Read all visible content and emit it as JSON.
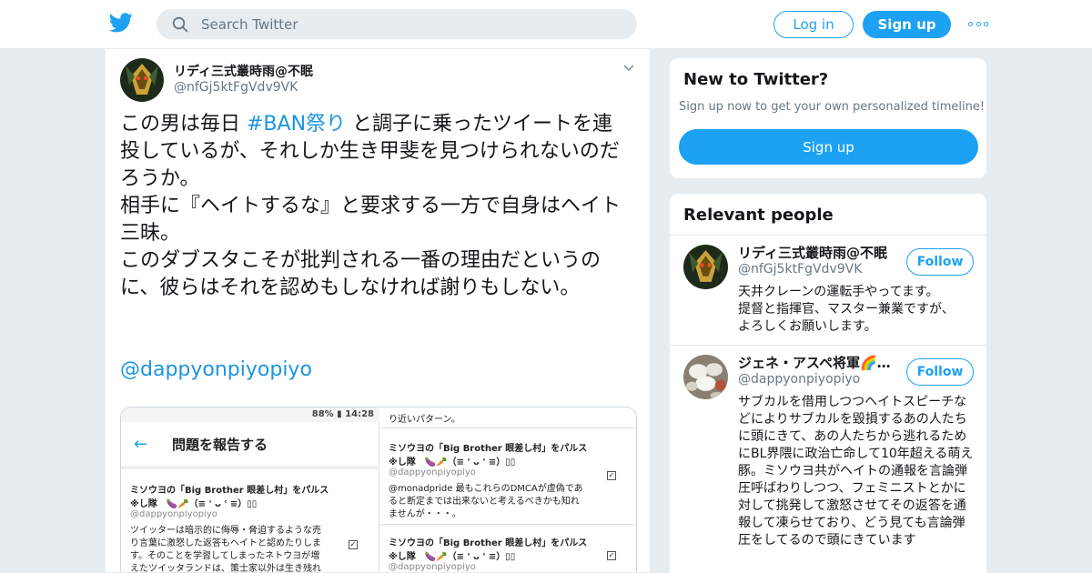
{
  "search": {
    "placeholder": "Search Twitter"
  },
  "header": {
    "login_label": "Log in",
    "signup_label": "Sign up"
  },
  "tweet": {
    "author_name": "リディ三式叢時雨@不眠",
    "author_handle": "@nfGj5ktFgVdv9VK",
    "text_before": "この男は毎日 ",
    "hashtag": "#BAN祭り",
    "text_after": " と調子に乗ったツイートを連投しているが、それしか生き甲斐を見つけられないのだろうか。\n相手に『ヘイトするな』と要求する一方で自身はヘイト三昧。\nこのダブスタこそが批判される一番の理由だというのに、彼らはそれを認めもしなければ謝りもしない。",
    "mention": "@dappyonpiyopiyo"
  },
  "screenshot": {
    "status": "88% ▮ 14:28",
    "app_title": "問題を報告する",
    "left_item": {
      "title": "ミソウヨの「Big Brother 眼差し村」をパルス",
      "title2": "※し隊　🍆🥕（≡ ' ᴗ ' ≡）▯▯",
      "handle": "@dappyonpiyopiyo",
      "line1": "ツイッターは暗示的に侮辱・脅迫するような売",
      "line2": "り言葉に激怒した返答もヘイトと認めたりしま",
      "line3": "す。そのことを学習してしまったネトウヨが増",
      "line4": "えたツイッタランドは、策士家以外は生き残れ"
    },
    "right_top": "り近いパターン。",
    "right_item1": {
      "title": "ミソウヨの「Big Brother 眼差し村」をパルス",
      "title2": "※し隊　🍆🥕（≡ ' ᴗ ' ≡）▯▯",
      "handle": "@dappyonpiyopiyo",
      "line1": "@monadpride 最もこれらのDMCAが虚偽であ",
      "line2": "ると断定までは出来ないと考えるべきかも知れ",
      "line3": "ませんが・・・。"
    },
    "right_item2": {
      "title": "ミソウヨの「Big Brother 眼差し村」をパルス",
      "title2": "※し隊　🍆🥕（≡ ' ᴗ ' ≡）▯▯",
      "handle": "@dappyonpiyopiyo"
    }
  },
  "new_to_twitter": {
    "title": "New to Twitter?",
    "subtitle": "Sign up now to get your own personalized timeline!",
    "button": "Sign up"
  },
  "relevant": {
    "title": "Relevant people",
    "people": [
      {
        "name": "リディ三式叢時雨@不眠",
        "handle": "@nfGj5ktFgVdv9VK",
        "follow": "Follow",
        "bio": "天井クレーンの運転手やってます。\n提督と指揮官、マスター兼業ですが、\nよろしくお願いします。"
      },
      {
        "name": "ジェネ・アスペ将軍🌈…",
        "handle": "@dappyonpiyopiyo",
        "follow": "Follow",
        "bio": "サブカルを借用しつつヘイトスピーチなどによりサブカルを毀損するあの人たちに頭にきて、あの人たちから逃れるためにBL界隈に政治亡命して10年超える萌え豚。ミソウヨ共がヘイトの通報を言論弾圧呼ばわりしつつ、フェミニストとかに対して挑発して激怒させてその返答を通報して凍らせており、どう見ても言論弾圧をしてるので頭にきています"
      }
    ]
  },
  "colors": {
    "accent": "#1da1f2",
    "link": "#1b95e0",
    "muted": "#657786",
    "background": "#e6ecf0"
  }
}
